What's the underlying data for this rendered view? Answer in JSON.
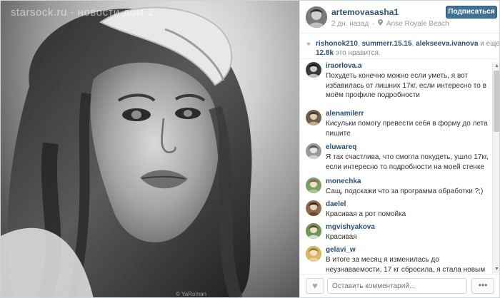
{
  "photo": {
    "watermark": "starsock.ru - новости дом-2",
    "credit": "© YaRoman"
  },
  "header": {
    "username": "artemovasasha1",
    "time": "2 дн. назад",
    "location": "Anse Royale Beach",
    "follow_label": "Подписаться",
    "pin_icon": "map-pin-icon"
  },
  "likes": {
    "users": [
      "rishonok210",
      "summerr.15.15",
      "alekseeva.ivanova"
    ],
    "separator": ",",
    "and_more": "и еще",
    "count": "12.8k",
    "suffix": "это нравится."
  },
  "comments": [
    {
      "user": "iraorlova.a",
      "text": "Похудеть конечно можно если уметь, я вот избавилась от лишних 17кг, если интересно то в моём профиле подробности",
      "avatar_color": "#3a3a3a"
    },
    {
      "user": "alenamilerr",
      "text": "Кисульки  помогу превести себя в форму до лета пишите ",
      "avatar_color": "#6f6152"
    },
    {
      "user": "eluwareq",
      "text": "Я так счастлива, что смогла похудеть, ушло 17кг, если интересно то подробности на моей стенке",
      "avatar_color": "#9a9a9a"
    },
    {
      "user": "monechka",
      "text": "Сащ, подскажи что за программа обработки ?;)",
      "avatar_color": "#7aa06a"
    },
    {
      "user": "daelel",
      "text": "Красивая а рот помойка",
      "avatar_color": "#8b6a4e"
    },
    {
      "user": "mgvishyakova",
      "text": "Красивая",
      "avatar_color": "#5f7f4a"
    },
    {
      "user": "gelavi_w",
      "text": "В итоге за месяц я изменилась до неузнаваемости, 17 кг сбросила, я стала новым человеком!",
      "avatar_color": "#c8a24a"
    }
  ],
  "footer": {
    "comment_placeholder": "Оставить комментарий...",
    "more_label": "•••"
  }
}
